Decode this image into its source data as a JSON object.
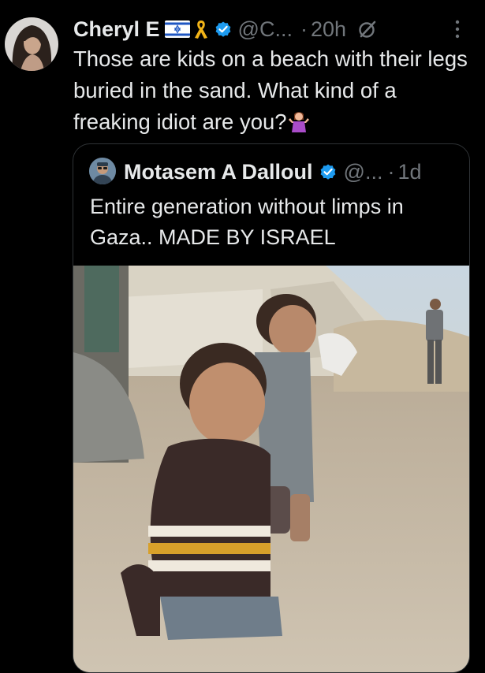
{
  "tweet": {
    "author_name": "Cheryl E",
    "handle": "@C...",
    "dot": "·",
    "time": "20h",
    "text": "Those are kids on a beach with their legs buried in the sand. What kind of a freaking idiot are you?"
  },
  "quoted": {
    "author_name": "Motasem A Dalloul",
    "handle": "@...",
    "dot": "·",
    "time": "1d",
    "text": "Entire generation without limps in Gaza.. MADE BY ISRAEL"
  },
  "colors": {
    "background": "#000000",
    "text": "#e7e9ea",
    "muted": "#71767b",
    "verified": "#1d9bf0",
    "border": "#2f3336"
  },
  "icons": [
    "israel-flag-icon",
    "yellow-ribbon-icon",
    "verified-badge-icon",
    "grok-icon",
    "more-icon",
    "shrug-emoji-icon"
  ]
}
